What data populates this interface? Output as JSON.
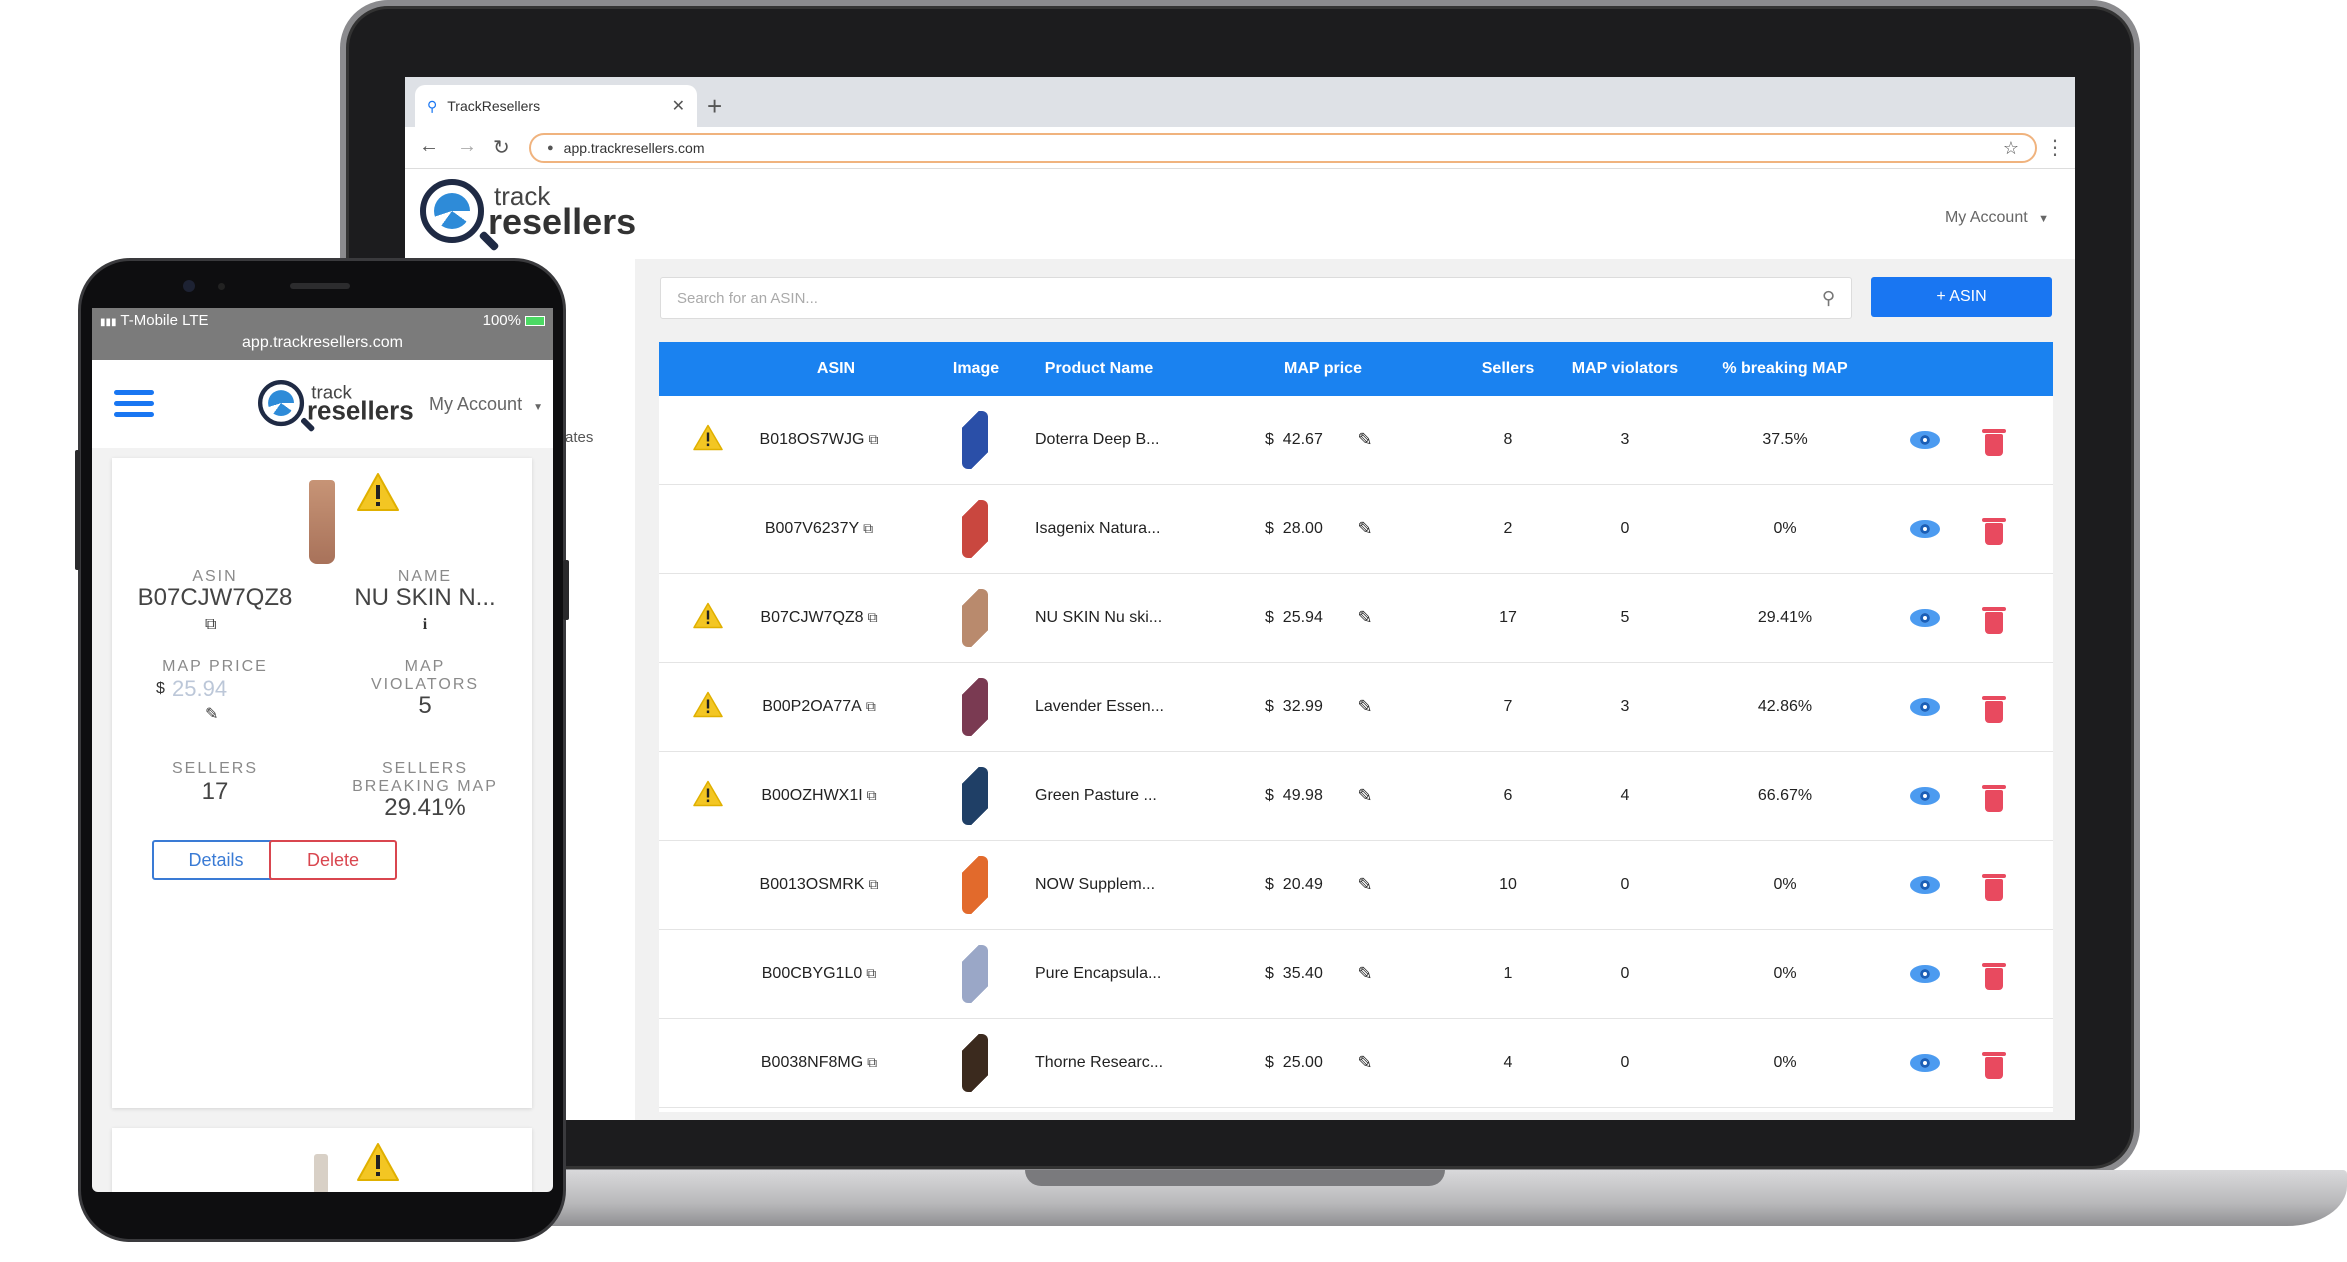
{
  "browser": {
    "tab_title": "TrackResellers",
    "url": "app.trackresellers.com"
  },
  "app": {
    "logo_top": "track",
    "logo_bottom": "resellers",
    "account_label": "My Account",
    "sidebar_fragment": "ates",
    "search_placeholder": "Search for an ASIN...",
    "add_button": "+ ASIN"
  },
  "table": {
    "headers": [
      "ASIN",
      "Image",
      "Product Name",
      "MAP price",
      "Sellers",
      "MAP violators",
      "% breaking MAP"
    ],
    "rows": [
      {
        "warn": true,
        "asin": "B018OS7WJG",
        "name": "Doterra Deep B...",
        "currency": "$",
        "price": "42.67",
        "sellers": "8",
        "violators": "3",
        "breaking": "37.5%",
        "img": "#2a4fa8"
      },
      {
        "warn": false,
        "asin": "B007V6237Y",
        "name": "Isagenix Natura...",
        "currency": "$",
        "price": "28.00",
        "sellers": "2",
        "violators": "0",
        "breaking": "0%",
        "img": "#c9473f"
      },
      {
        "warn": true,
        "asin": "B07CJW7QZ8",
        "name": "NU SKIN Nu ski...",
        "currency": "$",
        "price": "25.94",
        "sellers": "17",
        "violators": "5",
        "breaking": "29.41%",
        "img": "#b98a6d"
      },
      {
        "warn": true,
        "asin": "B00P2OA77A",
        "name": "Lavender Essen...",
        "currency": "$",
        "price": "32.99",
        "sellers": "7",
        "violators": "3",
        "breaking": "42.86%",
        "img": "#7a3a52"
      },
      {
        "warn": true,
        "asin": "B00OZHWX1I",
        "name": "Green Pasture ...",
        "currency": "$",
        "price": "49.98",
        "sellers": "6",
        "violators": "4",
        "breaking": "66.67%",
        "img": "#1f3f66"
      },
      {
        "warn": false,
        "asin": "B0013OSMRK",
        "name": "NOW Supplem...",
        "currency": "$",
        "price": "20.49",
        "sellers": "10",
        "violators": "0",
        "breaking": "0%",
        "img": "#e26a2c"
      },
      {
        "warn": false,
        "asin": "B00CBYG1L0",
        "name": "Pure Encapsula...",
        "currency": "$",
        "price": "35.40",
        "sellers": "1",
        "violators": "0",
        "breaking": "0%",
        "img": "#9aa7c7"
      },
      {
        "warn": false,
        "asin": "B0038NF8MG",
        "name": "Thorne Researc...",
        "currency": "$",
        "price": "25.00",
        "sellers": "4",
        "violators": "0",
        "breaking": "0%",
        "img": "#3b2a1e"
      }
    ]
  },
  "phone": {
    "carrier": "T-Mobile  LTE",
    "battery": "100%",
    "url": "app.trackresellers.com",
    "account_label": "My Account",
    "card": {
      "asin_label": "ASIN",
      "asin": "B07CJW7QZ8",
      "name_label": "NAME",
      "name": "NU SKIN N...",
      "info": "i",
      "map_price_label": "MAP PRICE",
      "currency": "$",
      "map_price": "25.94",
      "map_violators_label_1": "MAP",
      "map_violators_label_2": "VIOLATORS",
      "map_violators": "5",
      "sellers_label": "SELLERS",
      "sellers": "17",
      "breaking_label_1": "SELLERS",
      "breaking_label_2": "BREAKING MAP",
      "breaking": "29.41%",
      "details_button": "Details",
      "delete_button": "Delete"
    }
  },
  "colors": {
    "primary": "#1976f2",
    "table_header": "#1a82f0",
    "warning": "#f3c623",
    "danger": "#e84a5f",
    "eye": "#4c9bf0"
  }
}
